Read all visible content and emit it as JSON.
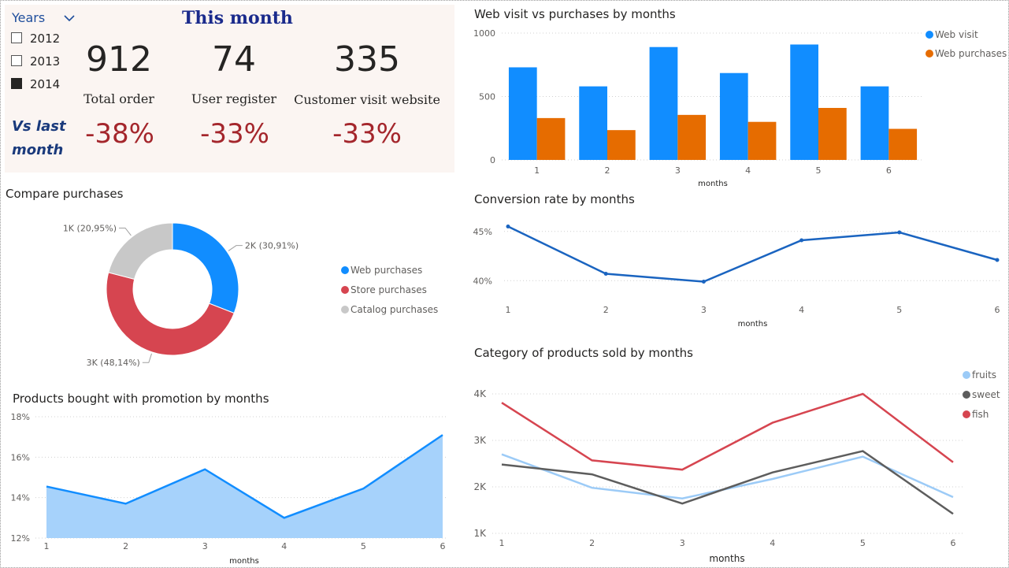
{
  "slicer": {
    "title": "Years",
    "items": [
      {
        "label": "2012",
        "checked": false
      },
      {
        "label": "2013",
        "checked": false
      },
      {
        "label": "2014",
        "checked": true
      }
    ]
  },
  "kpi": {
    "title": "This  month",
    "vs_line1": "Vs last",
    "vs_line2": "month",
    "cards": [
      {
        "value": "912",
        "label": "Total order",
        "change": "-38%"
      },
      {
        "value": "74",
        "label": "User register",
        "change": "-33%"
      },
      {
        "value": "335",
        "label": "Customer visit website",
        "change": "-33%"
      }
    ]
  },
  "colors": {
    "web_visit": "#118dff",
    "web_purchases": "#e66c00",
    "store": "#d64550",
    "catalog": "#c8c8c8",
    "line_blue": "#1a64c0",
    "fruits": "#9ccbf7",
    "sweet": "#5d5d5d",
    "fish": "#d64550",
    "area_fill": "#a6d2fb",
    "area_line": "#118dff",
    "negative": "#a4262c"
  },
  "chart_data": [
    {
      "id": "web_visit_vs_purchases",
      "type": "bar",
      "title": "Web visit vs purchases by months",
      "xlabel": "months",
      "categories": [
        "1",
        "2",
        "3",
        "4",
        "5",
        "6"
      ],
      "series": [
        {
          "name": "Web visit",
          "values": [
            730,
            580,
            890,
            685,
            910,
            580
          ]
        },
        {
          "name": "Web purchases",
          "values": [
            330,
            235,
            355,
            300,
            410,
            245
          ]
        }
      ],
      "ylim": [
        0,
        1000
      ],
      "yticks": [
        "0",
        "500",
        "1000"
      ],
      "legend": "top-right",
      "grid": true
    },
    {
      "id": "compare_purchases",
      "type": "pie",
      "title": "Compare purchases",
      "slices": [
        {
          "name": "Web purchases",
          "value": 30.91,
          "label": "2K (30,91%)"
        },
        {
          "name": "Store purchases",
          "value": 48.14,
          "label": "3K (48,14%)"
        },
        {
          "name": "Catalog purchases",
          "value": 20.95,
          "label": "1K (20,95%)"
        }
      ],
      "legend": "right"
    },
    {
      "id": "conversion_rate",
      "type": "line",
      "title": "Conversion rate by months",
      "xlabel": "months",
      "x": [
        "1",
        "2",
        "3",
        "4",
        "5",
        "6"
      ],
      "series": [
        {
          "values": [
            45.5,
            40.7,
            39.9,
            44.1,
            44.9,
            42.1
          ]
        }
      ],
      "ylim": [
        38.5,
        46.5
      ],
      "yticks": [
        "40%",
        "45%"
      ],
      "grid": true
    },
    {
      "id": "promotion",
      "type": "area",
      "title": "Products bought with promotion by months",
      "xlabel": "months",
      "x": [
        "1",
        "2",
        "3",
        "4",
        "5",
        "6"
      ],
      "series": [
        {
          "values": [
            14.55,
            13.7,
            15.4,
            13.0,
            14.45,
            17.1
          ]
        }
      ],
      "ylim": [
        12,
        18
      ],
      "yticks": [
        "12%",
        "14%",
        "16%",
        "18%"
      ],
      "grid": true
    },
    {
      "id": "category_products",
      "type": "line",
      "title": "Category of products sold by months",
      "xlabel": "months",
      "x": [
        "1",
        "2",
        "3",
        "4",
        "5",
        "6"
      ],
      "series": [
        {
          "name": "fruits",
          "values": [
            2700,
            1980,
            1750,
            2170,
            2650,
            1780
          ]
        },
        {
          "name": "sweet",
          "values": [
            2480,
            2270,
            1640,
            2310,
            2770,
            1420
          ]
        },
        {
          "name": "fish",
          "values": [
            3810,
            2570,
            2370,
            3380,
            4000,
            2530
          ]
        }
      ],
      "ylim": [
        1000,
        4000
      ],
      "yticks": [
        "1K",
        "2K",
        "3K",
        "4K"
      ],
      "legend": "top-right",
      "grid": true
    }
  ]
}
